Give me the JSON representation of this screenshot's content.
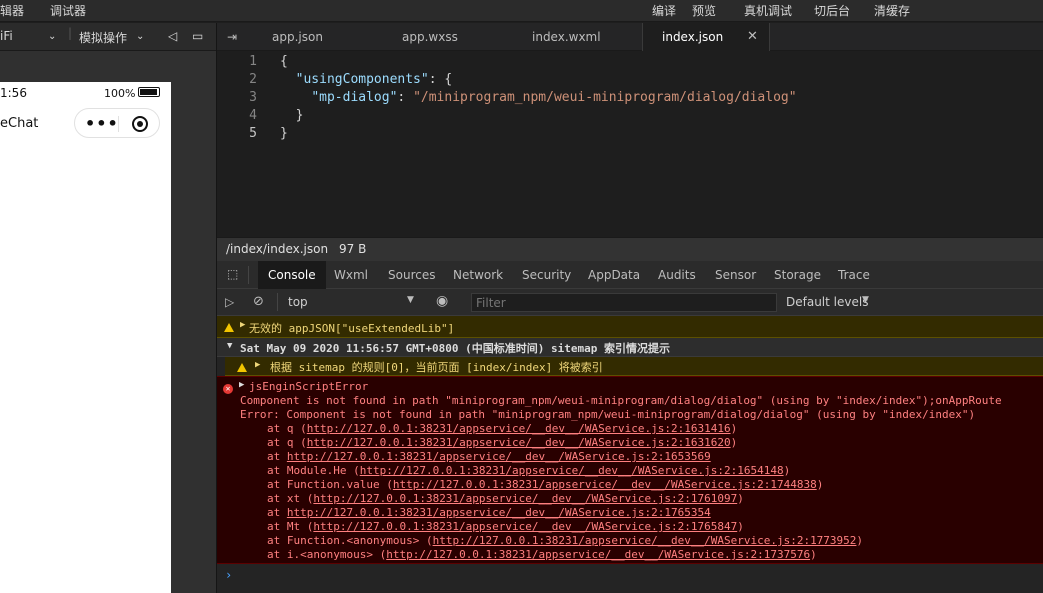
{
  "menubar": {
    "left": [
      "辑器",
      "调试器"
    ],
    "right": [
      "编译",
      "预览",
      "真机调试",
      "切后台",
      "清缓存"
    ]
  },
  "sim_toolbar": {
    "network": "iFi",
    "simulate": "模拟操作"
  },
  "phone": {
    "time": "1:56",
    "battery": "100%",
    "title": "eChat"
  },
  "tabs": [
    {
      "label": "app.json"
    },
    {
      "label": "app.wxss"
    },
    {
      "label": "index.wxml"
    },
    {
      "label": "index.json"
    }
  ],
  "editor": {
    "line_numbers": [
      "1",
      "2",
      "3",
      "4",
      "5"
    ],
    "lines": [
      {
        "p1": "{",
        "k": "",
        "p2": "",
        "s": "",
        "p3": ""
      },
      {
        "p1": "  ",
        "k": "\"usingComponents\"",
        "p2": ": {",
        "s": "",
        "p3": ""
      },
      {
        "p1": "    ",
        "k": "\"mp-dialog\"",
        "p2": ": ",
        "s": "\"/miniprogram_npm/weui-miniprogram/dialog/dialog\"",
        "p3": ""
      },
      {
        "p1": "  }",
        "k": "",
        "p2": "",
        "s": "",
        "p3": ""
      },
      {
        "p1": "}",
        "k": "",
        "p2": "",
        "s": "",
        "p3": ""
      }
    ]
  },
  "file_status": {
    "path": "/index/index.json",
    "size": "97 B"
  },
  "devtools_tabs": [
    "Console",
    "Wxml",
    "Sources",
    "Network",
    "Security",
    "AppData",
    "Audits",
    "Sensor",
    "Storage",
    "Trace"
  ],
  "console_bar": {
    "context": "top",
    "filter_placeholder": "Filter",
    "levels": "Default levels"
  },
  "console": {
    "warn1": "无效的 appJSON[\"useExtendedLib\"]",
    "group": "Sat May 09 2020 11:56:57 GMT+0800 (中国标准时间) sitemap 索引情况提示",
    "warn2": "根据 sitemap 的规则[0]，当前页面 [index/index] 将被索引",
    "error_title": "jsEnginScriptError",
    "error_lines": [
      "Component is not found in path \"miniprogram_npm/weui-miniprogram/dialog/dialog\" (using by \"index/index\");onAppRoute",
      "Error: Component is not found in path \"miniprogram_npm/weui-miniprogram/dialog/dialog\" (using by \"index/index\")"
    ],
    "stack": [
      {
        "prefix": "at q (",
        "link": "http://127.0.0.1:38231/appservice/__dev__/WAService.js:2:1631416",
        "suffix": ")"
      },
      {
        "prefix": "at q (",
        "link": "http://127.0.0.1:38231/appservice/__dev__/WAService.js:2:1631620",
        "suffix": ")"
      },
      {
        "prefix": "at ",
        "link": "http://127.0.0.1:38231/appservice/__dev__/WAService.js:2:1653569",
        "suffix": ""
      },
      {
        "prefix": "at Module.He (",
        "link": "http://127.0.0.1:38231/appservice/__dev__/WAService.js:2:1654148",
        "suffix": ")"
      },
      {
        "prefix": "at Function.value (",
        "link": "http://127.0.0.1:38231/appservice/__dev__/WAService.js:2:1744838",
        "suffix": ")"
      },
      {
        "prefix": "at xt (",
        "link": "http://127.0.0.1:38231/appservice/__dev__/WAService.js:2:1761097",
        "suffix": ")"
      },
      {
        "prefix": "at ",
        "link": "http://127.0.0.1:38231/appservice/__dev__/WAService.js:2:1765354",
        "suffix": ""
      },
      {
        "prefix": "at Mt (",
        "link": "http://127.0.0.1:38231/appservice/__dev__/WAService.js:2:1765847",
        "suffix": ")"
      },
      {
        "prefix": "at Function.<anonymous> (",
        "link": "http://127.0.0.1:38231/appservice/__dev__/WAService.js:2:1773952",
        "suffix": ")"
      },
      {
        "prefix": "at i.<anonymous> (",
        "link": "http://127.0.0.1:38231/appservice/__dev__/WAService.js:2:1737576",
        "suffix": ")"
      }
    ]
  },
  "colors": {
    "error_bg": "#290000",
    "warn_bg": "#332b00",
    "json_key": "#9cdcfe",
    "json_string": "#ce9178"
  }
}
